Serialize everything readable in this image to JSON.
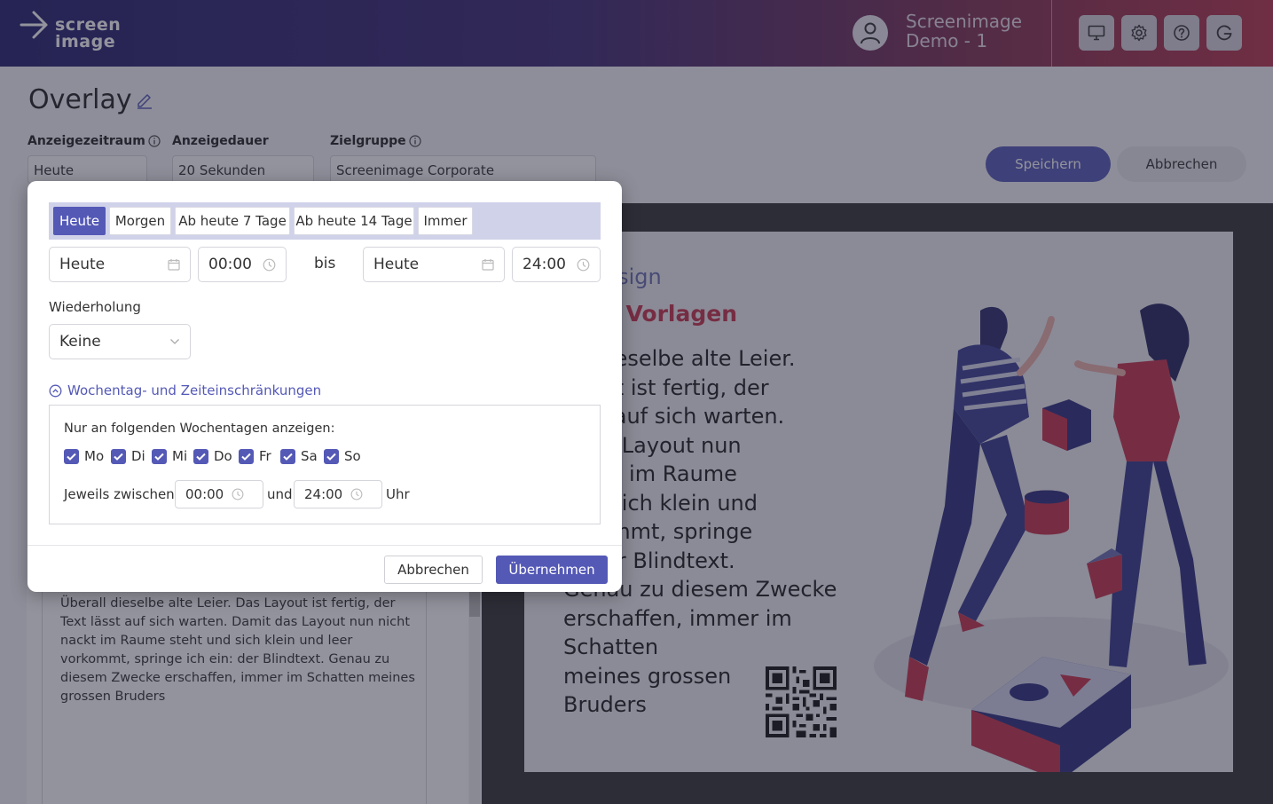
{
  "header": {
    "logo_line1": "screen",
    "logo_line2": "image",
    "user_line1": "Screenimage",
    "user_line2": "Demo - 1",
    "icons": [
      "monitor-icon",
      "gear-icon",
      "help-icon",
      "google-icon"
    ]
  },
  "page": {
    "title": "Overlay",
    "fields": [
      {
        "label": "Anzeigezeitraum",
        "value": "Heute"
      },
      {
        "label": "Anzeigedauer",
        "value": "20 Sekunden"
      },
      {
        "label": "Zielgruppe",
        "value": "Screenimage Corporate"
      }
    ],
    "save_label": "Speichern",
    "cancel_label": "Abbrechen"
  },
  "editor": {
    "text": "Überall dieselbe alte Leier. Das Layout ist fertig, der Text lässt auf sich warten. Damit das Layout nun nicht nackt im Raume steht und sich klein und leer vorkommt, springe ich ein: der Blindtext. Genau zu diesem Zwecke erschaffen, immer im Schatten meines grossen Bruders"
  },
  "preview": {
    "line1": "gen Design",
    "line2": "duelle Vorlagen",
    "body_lines": [
      "all dieselbe alte Leier.",
      "ayout ist fertig, der",
      "ässt auf sich warten.",
      ": das Layout nun",
      "nackt im Raume",
      "und sich klein und",
      "orkommt, springe",
      "n: der Blindtext.",
      "Genau zu diesem Zwecke",
      "erschaffen, immer im",
      "Schatten",
      "meines grossen",
      "Bruders"
    ]
  },
  "modal": {
    "quick": [
      "Heute",
      "Morgen",
      "Ab heute 7 Tage",
      "Ab heute 14 Tage",
      "Immer"
    ],
    "active_quick": "Heute",
    "from_date": "Heute",
    "from_time": "00:00",
    "bis": "bis",
    "to_date": "Heute",
    "to_time": "24:00",
    "repeat_label": "Wiederholung",
    "repeat_value": "Keine",
    "toggle_label": "Wochentag- und Zeiteinschränkungen",
    "weekday_label": "Nur an folgenden Wochentagen anzeigen:",
    "days": [
      "Mo",
      "Di",
      "Mi",
      "Do",
      "Fr",
      "Sa",
      "So"
    ],
    "between_label": "Jeweils zwischen",
    "between_from": "00:00",
    "and_label": "und",
    "between_to": "24:00",
    "uhr_label": "Uhr",
    "cancel": "Abbrechen",
    "apply": "Übernehmen"
  },
  "colors": {
    "accent": "#5459b6",
    "slide_red": "#c4324a",
    "slide_blue": "#6a6fb0"
  }
}
